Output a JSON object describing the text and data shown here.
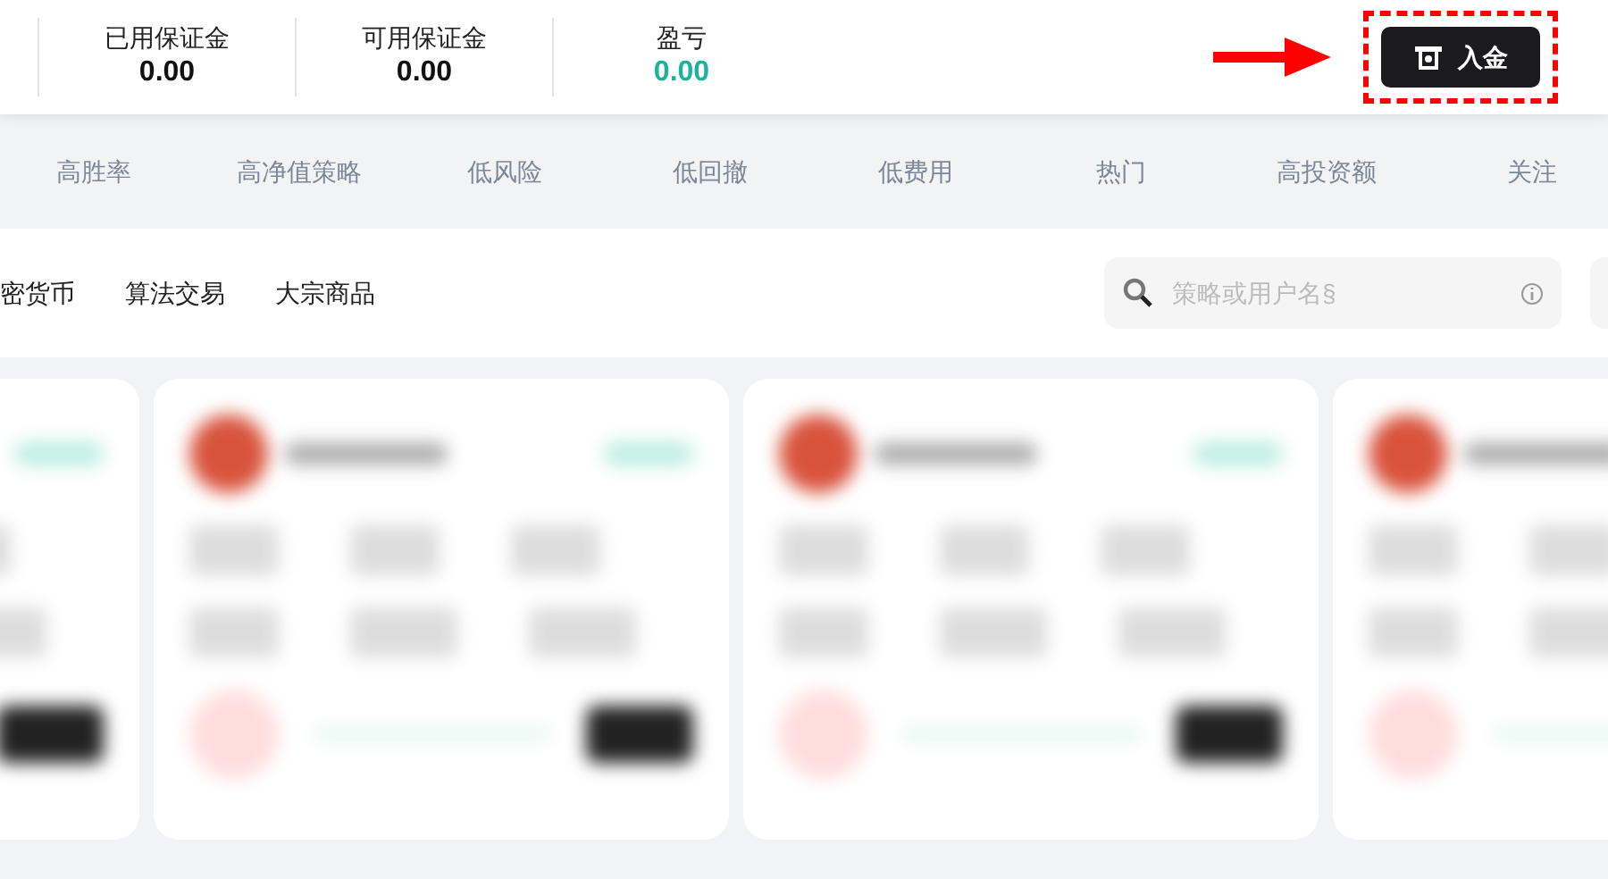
{
  "stats": [
    {
      "label": "已用保证金",
      "value": "0.00",
      "kind": "plain"
    },
    {
      "label": "可用保证金",
      "value": "0.00",
      "kind": "plain"
    },
    {
      "label": "盈亏",
      "value": "0.00",
      "kind": "profit"
    }
  ],
  "deposit_button": {
    "label": "入金"
  },
  "category_tabs": [
    "高胜率",
    "高净值策略",
    "低风险",
    "低回撤",
    "低费用",
    "热门",
    "高投资额",
    "关注"
  ],
  "filters": [
    "密货币",
    "算法交易",
    "大宗商品"
  ],
  "search": {
    "placeholder": "策略或用户名§"
  }
}
